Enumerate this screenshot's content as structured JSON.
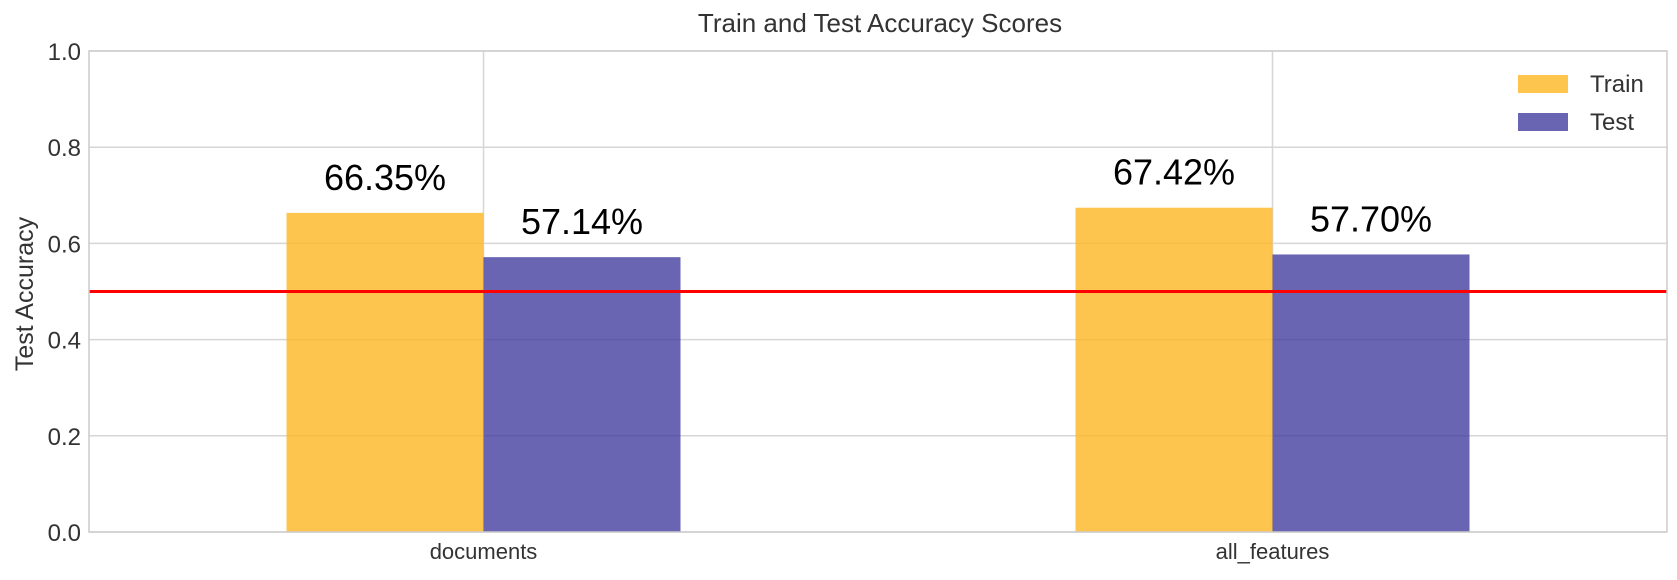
{
  "chart_data": {
    "type": "bar",
    "title": "Train and Test Accuracy Scores",
    "xlabel": "",
    "ylabel": "Test Accuracy",
    "categories": [
      "documents",
      "all_features"
    ],
    "series": [
      {
        "name": "Train",
        "values": [
          0.6635,
          0.6742
        ],
        "labels": [
          "66.35%",
          "67.42%"
        ],
        "color": "#FDB827"
      },
      {
        "name": "Test",
        "values": [
          0.5714,
          0.577
        ],
        "labels": [
          "57.14%",
          "57.70%"
        ],
        "color": "#3F3A9E"
      }
    ],
    "ylim": [
      0,
      1.0
    ],
    "yticks": [
      0.0,
      0.2,
      0.4,
      0.6,
      0.8,
      1.0
    ],
    "ytick_labels": [
      "0.0",
      "0.2",
      "0.4",
      "0.6",
      "0.8",
      "1.0"
    ],
    "reference_line": {
      "y": 0.5,
      "color": "#FF0000"
    },
    "grid": true,
    "legend_position": "top-right"
  }
}
